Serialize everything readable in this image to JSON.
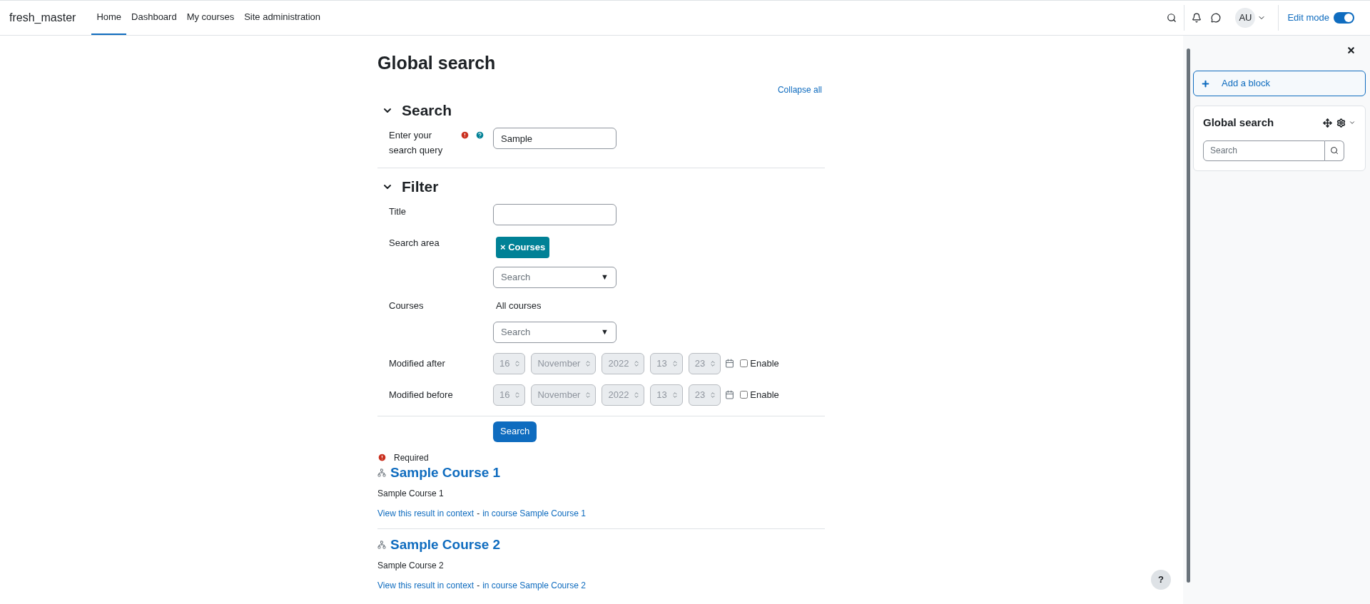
{
  "navbar": {
    "site_name": "fresh_master",
    "items": [
      {
        "label": "Home",
        "selected": true
      },
      {
        "label": "Dashboard",
        "selected": false
      },
      {
        "label": "My courses",
        "selected": false
      },
      {
        "label": "Site administration",
        "selected": false
      }
    ],
    "user_initials": "AU",
    "edit_mode": {
      "label": "Edit mode",
      "on": true
    }
  },
  "page": {
    "title": "Global search",
    "collapse_all": "Collapse all",
    "sections": [
      {
        "title": "Search",
        "expanded": true,
        "fields": [
          {
            "kind": "text",
            "label": "Enter your search query",
            "value": "Sample",
            "required": true,
            "help": true
          }
        ]
      },
      {
        "title": "Filter",
        "expanded": true,
        "fields": [
          {
            "kind": "text",
            "label": "Title",
            "required": false,
            "help": false
          },
          {
            "kind": "autocomplete",
            "label": "Search area",
            "tags": [
              {
                "remove": "×",
                "label": "Courses"
              }
            ],
            "placeholder": "Search",
            "caret": "▼"
          },
          {
            "kind": "autocomplete",
            "label": "Courses",
            "selection_text": "All courses",
            "placeholder": "Search",
            "caret": "▼"
          },
          {
            "kind": "date",
            "label": "Modified after",
            "parts": [
              "16",
              "November",
              "2022",
              "13",
              "23"
            ],
            "enabled": false,
            "enable_label": "Enable"
          },
          {
            "kind": "date",
            "label": "Modified before",
            "parts": [
              "16",
              "November",
              "2022",
              "13",
              "23"
            ],
            "enabled": false,
            "enable_label": "Enable"
          }
        ]
      }
    ],
    "submit": "Search",
    "required_note": "Required",
    "results": [
      {
        "title": "Sample Course 1",
        "description": "Sample Course 1",
        "context_link": "View this result in context",
        "separator": "-",
        "course_link": "in course Sample Course 1"
      },
      {
        "title": "Sample Course 2",
        "description": "Sample Course 2",
        "context_link": "View this result in context",
        "separator": "-",
        "course_link": "in course Sample Course 2"
      }
    ]
  },
  "drawer": {
    "add_block": "Add a block",
    "block": {
      "title": "Global search",
      "search_placeholder": "Search"
    }
  },
  "help_button": "?"
}
